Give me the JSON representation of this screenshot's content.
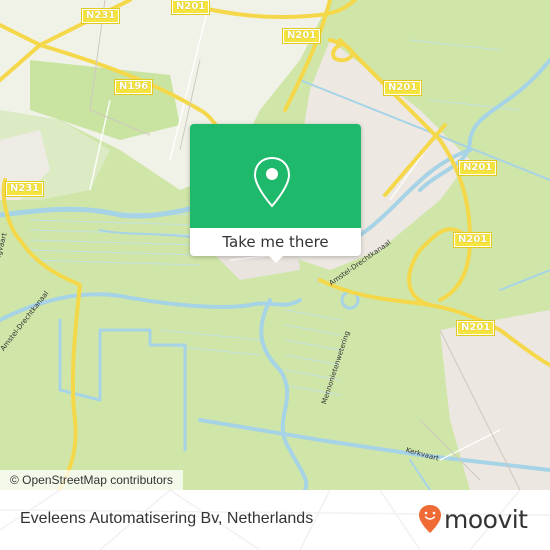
{
  "map": {
    "road_labels": [
      {
        "text": "N231"
      },
      {
        "text": "N201"
      },
      {
        "text": "N196"
      },
      {
        "text": "N201"
      },
      {
        "text": "N201"
      },
      {
        "text": "N231"
      },
      {
        "text": "N201"
      },
      {
        "text": "N201"
      },
      {
        "text": "N201"
      }
    ],
    "water_labels": [
      {
        "text": "Ringvaart"
      },
      {
        "text": "Amstel-Drechtkanaal"
      },
      {
        "text": "Amstel-Drechtkanaal"
      },
      {
        "text": "Mennonietenwetering"
      },
      {
        "text": "Kerkvaart"
      }
    ],
    "colors": {
      "land": "#cfe6a8",
      "urban": "#f2efe9",
      "water": "#aad3df",
      "road": "#f7dc4f",
      "accent": "#1eb96a"
    }
  },
  "popup": {
    "icon": "location-pin-icon",
    "button_label": "Take me there"
  },
  "attribution": {
    "text": "© OpenStreetMap contributors"
  },
  "footer": {
    "place_name": "Eveleens Automatisering Bv, Netherlands",
    "brand": "moovit",
    "brand_color": "#f06a35"
  }
}
